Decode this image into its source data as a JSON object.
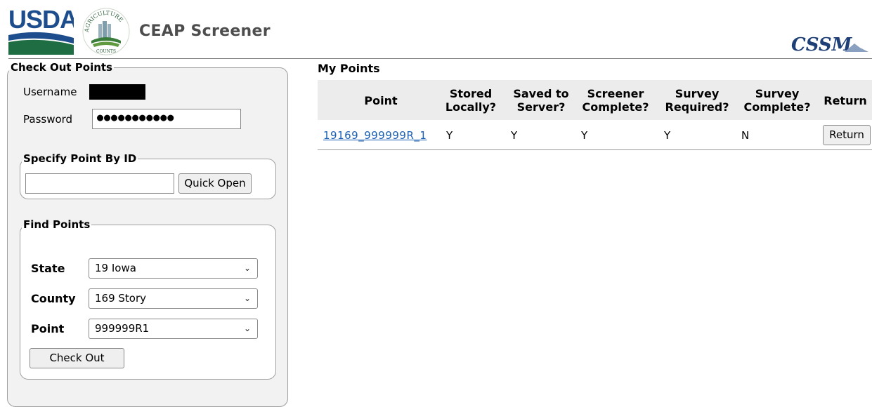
{
  "header": {
    "usda_logo_text": "USDA",
    "seal_text_top": "AGRICULTURE",
    "seal_text_bottom": "COUNTS",
    "app_title": "CEAP Screener",
    "partner_logo_text": "CSSM"
  },
  "checkout_panel": {
    "legend": "Check Out Points",
    "username_label": "Username",
    "password_label": "Password",
    "password_value": "●●●●●●●●●●●"
  },
  "specify_panel": {
    "legend": "Specify Point By ID",
    "id_value": "",
    "quick_open_label": "Quick Open"
  },
  "find_panel": {
    "legend": "Find Points",
    "state_label": "State",
    "state_value": "19 Iowa",
    "county_label": "County",
    "county_value": "169 Story",
    "point_label": "Point",
    "point_value": "999999R1",
    "check_out_label": "Check Out"
  },
  "my_points": {
    "title": "My Points",
    "columns": [
      {
        "line1": "Point",
        "line2": ""
      },
      {
        "line1": "Stored",
        "line2": "Locally?"
      },
      {
        "line1": "Saved to",
        "line2": "Server?"
      },
      {
        "line1": "Screener",
        "line2": "Complete?"
      },
      {
        "line1": "Survey",
        "line2": "Required?"
      },
      {
        "line1": "Survey",
        "line2": "Complete?"
      },
      {
        "line1": "Return",
        "line2": ""
      }
    ],
    "rows": [
      {
        "point": "19169_999999R_1",
        "stored_locally": "Y",
        "saved_to_server": "Y",
        "screener_complete": "Y",
        "survey_required": "Y",
        "survey_complete": "N",
        "return_label": "Return"
      }
    ]
  },
  "colors": {
    "usda_blue": "#1d4d8c",
    "usda_green": "#1f6e43",
    "title_gray": "#4d4d4d",
    "link_blue": "#1a5fb4",
    "panel_bg": "#f2f2f2",
    "table_header_bg": "#ececec"
  }
}
